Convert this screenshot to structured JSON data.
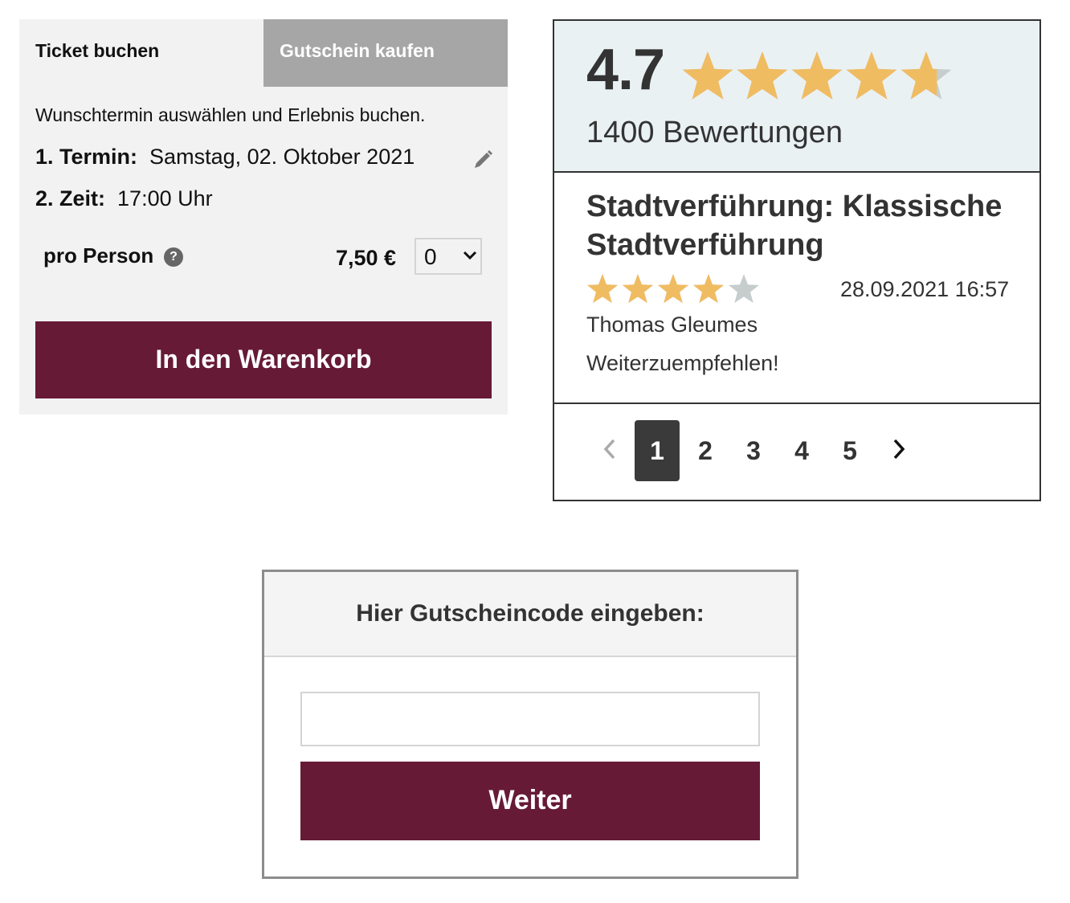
{
  "colors": {
    "brand": "#661a36",
    "star_filled": "#f0bc62",
    "star_empty": "#c7cdcd",
    "inactive_tab": "#a6a6a6",
    "rating_header_bg": "#eaf1f3"
  },
  "booking": {
    "tabs": [
      {
        "label": "Ticket buchen",
        "active": true
      },
      {
        "label": "Gutschein kaufen",
        "active": false
      }
    ],
    "intro": "Wunschtermin auswählen und Erlebnis buchen.",
    "date_label": "1. Termin:",
    "date_value": "Samstag, 02. Oktober 2021",
    "time_label": "2. Zeit:",
    "time_value": "17:00 Uhr",
    "per_person_label": "pro Person",
    "help_icon_glyph": "?",
    "price": "7,50 €",
    "quantity": "0",
    "cart_button": "In den Warenkorb"
  },
  "reviews": {
    "average": "4.7",
    "average_value": 4.7,
    "max_stars": 5,
    "count_text": "1400 Bewertungen",
    "items": [
      {
        "title": "Stadtverführung: Klassische Stadtverführung",
        "stars": 4,
        "date": "28.09.2021 16:57",
        "author": "Thomas Gleumes",
        "text": "Weiterzuempfehlen!"
      }
    ],
    "pagination": {
      "pages": [
        "1",
        "2",
        "3",
        "4",
        "5"
      ],
      "current": "1"
    }
  },
  "voucher": {
    "heading": "Hier Gutscheincode eingeben:",
    "input_value": "",
    "button": "Weiter"
  }
}
